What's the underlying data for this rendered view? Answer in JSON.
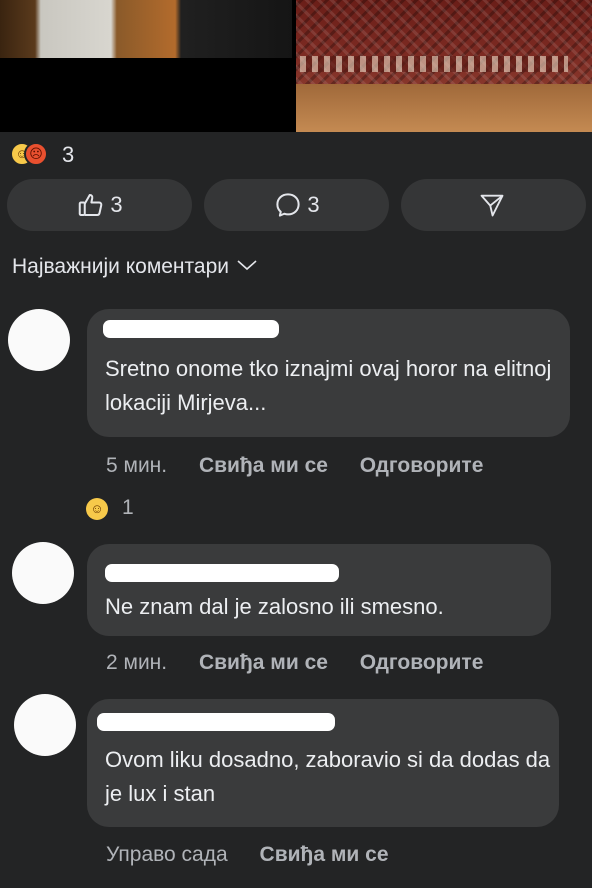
{
  "post": {
    "reactions": {
      "icons": [
        "haha-emoji",
        "angry-emoji"
      ],
      "count": "3"
    },
    "actions": {
      "like_count": "3",
      "comment_count": "3",
      "share_label": ""
    }
  },
  "comments_header": {
    "sort_label": "Најважнији коментари"
  },
  "comments": [
    {
      "text": "Sretno onome tko iznajmi ovaj horor na elitnoj lokaciji Mirjeva...",
      "time": "5 мин.",
      "like_label": "Свиђа ми се",
      "reply_label": "Одговорите",
      "reaction_count": "1"
    },
    {
      "text": "Ne znam dal je zalosno ili smesno.",
      "time": "2 мин.",
      "like_label": "Свиђа ми се",
      "reply_label": "Одговорите"
    },
    {
      "text": "Ovom liku dosadno, zaboravio si da dodas da je lux i stan",
      "time": "Управо сада",
      "like_label": "Свиђа ми се"
    }
  ],
  "colors": {
    "background": "#232425",
    "bubble": "#3a3b3c",
    "button": "#353637",
    "muted_text": "#b0b3b8"
  }
}
